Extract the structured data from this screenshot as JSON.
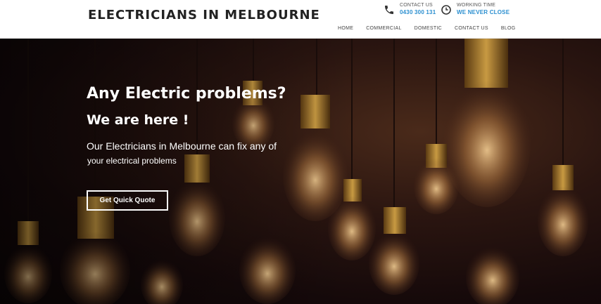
{
  "header": {
    "logo": "ELECTRICIANS IN MELBOURNE",
    "contact": {
      "label": "CONTACT US",
      "value": "0430 300 131",
      "icon": "phone-icon"
    },
    "hours": {
      "label": "WORKING TIME",
      "value": "WE NEVER CLOSE",
      "icon": "clock-icon"
    },
    "nav": [
      "HOME",
      "COMMERCIAL",
      "DOMESTIC",
      "CONTACT US",
      "BLOG"
    ]
  },
  "hero": {
    "headline": "Any Electric problems?",
    "subheadline": "We are here !",
    "text_line1": "Our Electricians in Melbourne can fix any of",
    "text_line2": "your electrical problems",
    "button": "Get Quick Quote"
  },
  "colors": {
    "accent": "#2b8fd0",
    "logo": "#222222",
    "hero_bg": "#1a0b0a"
  }
}
